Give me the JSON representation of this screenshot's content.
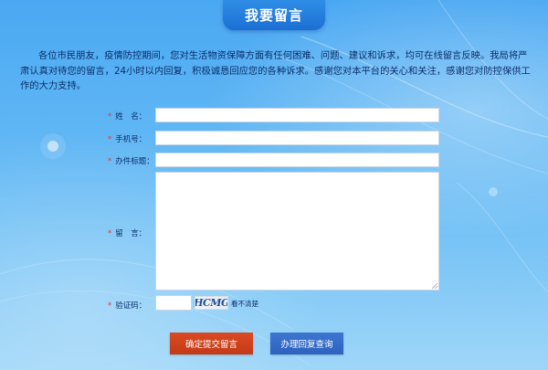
{
  "header": {
    "title": "我要留言"
  },
  "intro": {
    "text": "各位市民朋友，疫情防控期间，您对生活物资保障方面有任何困难、问题、建议和诉求，均可在线留言反映。我局将严肃认真对待您的留言，24小时以内回复，积极诚恳回应您的各种诉求。感谢您对本平台的关心和关注，感谢您对防控保供工作的大力支持。"
  },
  "form": {
    "required_mark": "*",
    "name_label": "姓　名：",
    "name_value": "",
    "phone_label": "手机号：",
    "phone_value": "",
    "subject_label": "办件标题：",
    "subject_value": "",
    "message_label": "留　言：",
    "message_value": "",
    "captcha_label": "验证码：",
    "captcha_value": "",
    "captcha_text": "HCMG",
    "captcha_refresh": "看不清楚"
  },
  "actions": {
    "submit_label": "确定提交留言",
    "query_label": "办理回复查询"
  },
  "colors": {
    "background": "#5fb6f4",
    "title_tab": "#1c6fd4",
    "submit_button": "#c43a17",
    "query_button": "#2d62be",
    "required_mark": "#e03a2f",
    "text": "#0b2f6b"
  }
}
